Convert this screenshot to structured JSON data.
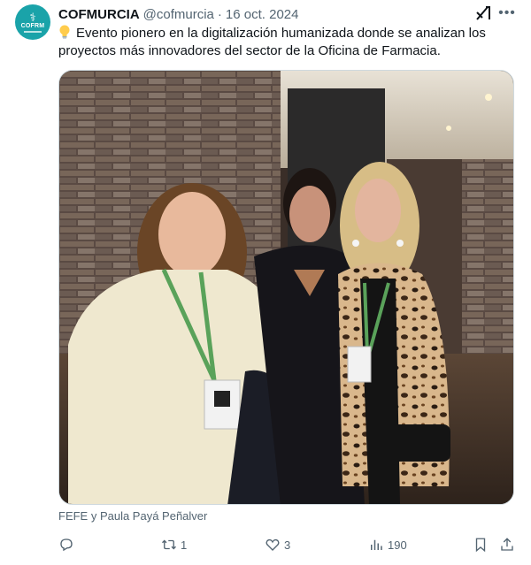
{
  "author": {
    "display_name": "COFMURCIA",
    "handle": "@cofmurcia",
    "separator": "·",
    "date": "16 oct. 2024",
    "avatar_text": "COFRM"
  },
  "tweet": {
    "emoji_icon": "light-bulb-icon",
    "text": "Evento pionero en la digitalización humanizada donde se analizan los proyectos más innovadores del sector de la Oficina de Farmacia."
  },
  "media": {
    "caption": "FEFE y Paula Payá Peñalver"
  },
  "actions": {
    "reply_count": "",
    "retweet_count": "1",
    "like_count": "3",
    "views_count": "190"
  },
  "icons": {
    "grok": "grok-icon",
    "more": "more-icon",
    "reply": "reply-icon",
    "retweet": "retweet-icon",
    "like": "heart-icon",
    "views": "views-icon",
    "bookmark": "bookmark-icon",
    "share": "share-icon"
  },
  "colors": {
    "avatar_bg": "#1aa3a9",
    "muted_text": "#536471",
    "text": "#0f1419"
  }
}
